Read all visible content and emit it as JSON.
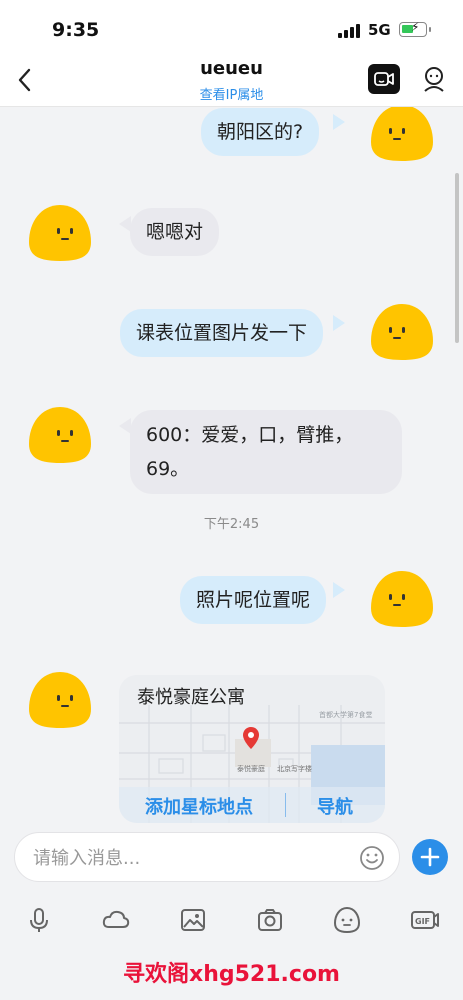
{
  "status_bar": {
    "time": "9:35",
    "network": "5G"
  },
  "header": {
    "title": "ueueu",
    "subtitle": "查看IP属地"
  },
  "messages": [
    {
      "sender": "me",
      "text": "朝阳区的?"
    },
    {
      "sender": "other",
      "text": "嗯嗯对"
    },
    {
      "sender": "me",
      "text": "课表位置图片发一下"
    },
    {
      "sender": "other",
      "text": "600：爱爱，口，臂推，69。"
    },
    {
      "sender": "me",
      "text": "照片呢位置呢"
    }
  ],
  "timestamp": "下午2:45",
  "location_card": {
    "title": "泰悦豪庭公寓",
    "star_label": "添加星标地点",
    "nav_label": "导航",
    "map_labels": {
      "poi": "泰悦豪庭",
      "gate": "北京写字楼",
      "university": "首都大学第7食堂"
    }
  },
  "input": {
    "placeholder": "请输入消息...",
    "value": ""
  },
  "toolbar_icons": [
    "microphone-icon",
    "cloud-icon",
    "image-icon",
    "camera-icon",
    "emoji-face-icon",
    "gif-icon"
  ],
  "watermark": "寻欢阁xhg521.com",
  "colors": {
    "accent": "#2b8ee8",
    "bubble_out": "#d6ecfb",
    "bubble_in": "#e9e9ee",
    "avatar": "#ffc400",
    "watermark": "#e9133a"
  }
}
